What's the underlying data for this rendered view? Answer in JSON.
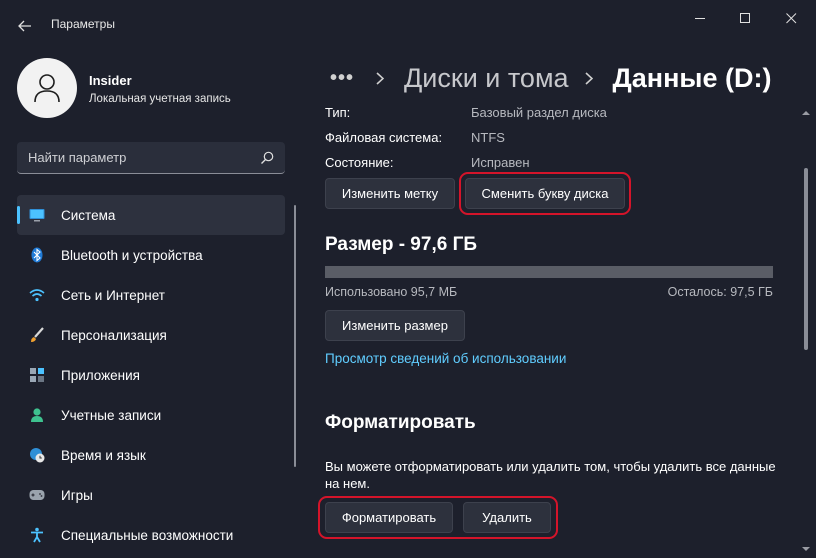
{
  "window": {
    "title": "Параметры"
  },
  "profile": {
    "name": "Insider",
    "account_type": "Локальная учетная запись"
  },
  "search": {
    "placeholder": "Найти параметр"
  },
  "nav": {
    "items": [
      {
        "label": "Система",
        "icon": "monitor-icon",
        "selected": true
      },
      {
        "label": "Bluetooth и устройства",
        "icon": "bluetooth-icon"
      },
      {
        "label": "Сеть и Интернет",
        "icon": "wifi-icon"
      },
      {
        "label": "Персонализация",
        "icon": "brush-icon"
      },
      {
        "label": "Приложения",
        "icon": "apps-icon"
      },
      {
        "label": "Учетные записи",
        "icon": "person-icon"
      },
      {
        "label": "Время и язык",
        "icon": "globe-clock-icon"
      },
      {
        "label": "Игры",
        "icon": "gamepad-icon"
      },
      {
        "label": "Специальные возможности",
        "icon": "accessibility-icon"
      }
    ]
  },
  "breadcrumb": {
    "dots": "•••",
    "parent": "Диски и тома",
    "current": "Данные (D:)"
  },
  "properties": [
    {
      "key": "Тип:",
      "value": "Базовый раздел диска"
    },
    {
      "key": "Файловая система:",
      "value": "NTFS"
    },
    {
      "key": "Состояние:",
      "value": "Исправен"
    }
  ],
  "actions": {
    "change_label": "Изменить метку",
    "change_letter": "Сменить букву диска"
  },
  "size": {
    "title": "Размер - 97,6 ГБ",
    "used": "Использовано 95,7 МБ",
    "free": "Осталось: 97,5 ГБ",
    "used_fraction": 0.001,
    "resize_button": "Изменить размер",
    "usage_link": "Просмотр сведений об использовании"
  },
  "format": {
    "title": "Форматировать",
    "description": "Вы можете отформатировать или удалить том, чтобы удалить все данные на нем.",
    "format_button": "Форматировать",
    "delete_button": "Удалить"
  },
  "colors": {
    "accent": "#4cc2ff",
    "link": "#60cdff",
    "highlight": "#d4142a",
    "background": "#1d202c"
  }
}
